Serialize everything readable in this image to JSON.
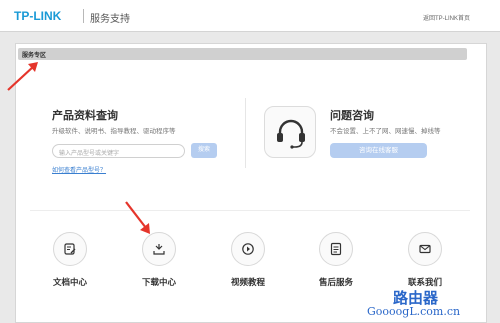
{
  "header": {
    "logo": "TP-LINK",
    "subtitle": "服务支持",
    "home_link": "返回TP-LINK首页"
  },
  "zone": {
    "label": "服务专区"
  },
  "product_lookup": {
    "title": "产品资料查询",
    "description": "升级软件、说明书、指导教程、驱动程序等",
    "search_placeholder": "输入产品型号或关键字",
    "search_button": "搜索",
    "help_link": "如何查看产品型号？"
  },
  "consult": {
    "title": "问题咨询",
    "description": "不会设置、上不了网、网速慢、掉线等",
    "button": "咨询在线客服"
  },
  "tiles": [
    {
      "label": "文档中心",
      "icon": "document-edit-icon"
    },
    {
      "label": "下载中心",
      "icon": "download-icon"
    },
    {
      "label": "视频教程",
      "icon": "video-play-icon"
    },
    {
      "label": "售后服务",
      "icon": "service-list-icon"
    },
    {
      "label": "联系我们",
      "icon": "mail-icon"
    }
  ],
  "watermark": {
    "chinese": "路由器",
    "url": "GoooogL.com.cn"
  },
  "colors": {
    "brand": "#1a9ad6",
    "button": "#b5cdf0",
    "arrow": "#e5352b"
  }
}
